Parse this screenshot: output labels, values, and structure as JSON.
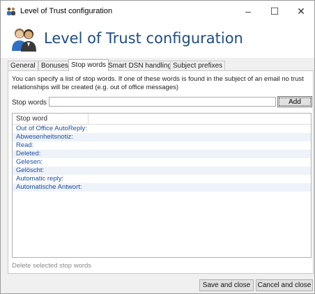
{
  "window": {
    "title": "Level of Trust configuration",
    "controls": {
      "minimize": "–",
      "maximize": "☐",
      "close": "✕"
    }
  },
  "header": {
    "title": "Level of Trust configuration",
    "icon": "users-icon"
  },
  "tabs": [
    {
      "label": "General",
      "active": false
    },
    {
      "label": "Bonuses",
      "active": false
    },
    {
      "label": "Stop words",
      "active": true
    },
    {
      "label": "Smart DSN handling",
      "active": false
    },
    {
      "label": "Subject prefixes",
      "active": false
    }
  ],
  "stop_words_tab": {
    "description": "You can specify a list of stop words. If one of these words is found in the subject of an email no trust relationships will be created (e.g. out of office messages)",
    "input_label": "Stop words",
    "input_value": "",
    "add_label": "Add",
    "column_header": "Stop word",
    "items": [
      "Out of Office AutoReply:",
      "Abwesenheitsnotiz:",
      "Read:",
      "Deleted:",
      "Gelesen:",
      "Gelöscht:",
      "Automatic reply:",
      "Automatische Antwort:"
    ],
    "delete_label": "Delete selected stop words"
  },
  "footer": {
    "save_label": "Save and close",
    "cancel_label": "Cancel and close"
  },
  "colors": {
    "accent": "#1d4d85",
    "link": "#1a4fa0",
    "row_alt": "#eef2f9"
  }
}
